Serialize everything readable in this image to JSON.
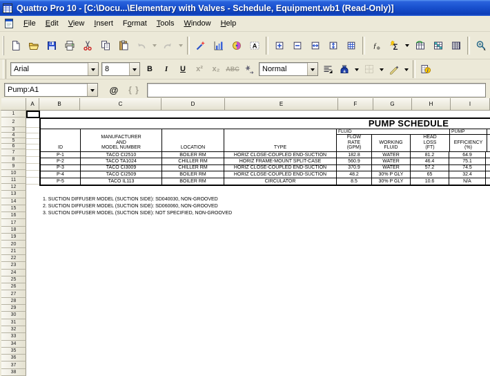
{
  "window": {
    "app_icon": "quattro-pro-app-icon",
    "title": "Quattro Pro 10 - [C:\\Docu...\\Elementary with Valves - Schedule, Equipment.wb1 (Read-Only)]"
  },
  "menus": [
    {
      "pre": "",
      "key": "F",
      "post": "ile"
    },
    {
      "pre": "",
      "key": "E",
      "post": "dit"
    },
    {
      "pre": "",
      "key": "V",
      "post": "iew"
    },
    {
      "pre": "",
      "key": "I",
      "post": "nsert"
    },
    {
      "pre": "F",
      "key": "o",
      "post": "rmat"
    },
    {
      "pre": "",
      "key": "T",
      "post": "ools"
    },
    {
      "pre": "",
      "key": "W",
      "post": "indow"
    },
    {
      "pre": "",
      "key": "H",
      "post": "elp"
    }
  ],
  "main_toolbar": {
    "items": [
      {
        "name": "new-document"
      },
      {
        "name": "open"
      },
      {
        "name": "save"
      },
      {
        "name": "print"
      },
      {
        "name": "cut"
      },
      {
        "name": "copy"
      },
      {
        "name": "paste"
      },
      {
        "name": "undo",
        "disabled": true
      },
      {
        "name": "undo-dropdown",
        "type": "arrow",
        "disabled": true
      },
      {
        "name": "redo",
        "disabled": true
      },
      {
        "name": "redo-dropdown",
        "type": "arrow",
        "disabled": true
      },
      {
        "type": "sep"
      },
      {
        "name": "quickformat"
      },
      {
        "name": "chart"
      },
      {
        "name": "clipart"
      },
      {
        "name": "text-box"
      },
      {
        "type": "sep"
      },
      {
        "name": "insert-cells"
      },
      {
        "name": "delete-cells"
      },
      {
        "name": "insert-columns"
      },
      {
        "name": "insert-rows"
      },
      {
        "name": "insert-sheet"
      },
      {
        "type": "sep"
      },
      {
        "name": "formula-composer"
      },
      {
        "name": "quicksum"
      },
      {
        "name": "quicksum-dropdown",
        "type": "arrow"
      },
      {
        "name": "speedformat"
      },
      {
        "name": "format-as-table"
      },
      {
        "name": "group-mode"
      },
      {
        "type": "sep"
      },
      {
        "name": "zoom"
      },
      {
        "name": "what-if"
      },
      {
        "name": "copy-cells"
      },
      {
        "name": "freeze-titles"
      },
      {
        "type": "sep"
      },
      {
        "name": "pan-workbook"
      }
    ]
  },
  "format_bar": {
    "font": "Arial",
    "size": "8",
    "style": "Normal",
    "bold": "B",
    "italic": "I",
    "underline": "U",
    "superscript": "x²",
    "subscript": "x₂",
    "strike": "ABC",
    "icon_buttons": [
      "insert-symbol",
      "alignment",
      "fill-color",
      "cell-borders",
      "line-color",
      "sheet-properties"
    ]
  },
  "formula_bar": {
    "cell_reference": "Pump:A1",
    "at_button": "@",
    "braces_button": "{ }",
    "input_value": ""
  },
  "sheet": {
    "selection": "A1",
    "columns": [
      "A",
      "B",
      "C",
      "D",
      "E",
      "F",
      "G",
      "H",
      "I"
    ],
    "row_numbers": [
      1,
      2,
      3,
      4,
      5,
      6,
      7,
      8,
      9,
      10,
      11,
      12,
      13,
      14,
      15,
      16,
      17,
      18,
      19,
      20,
      21,
      22,
      23,
      24,
      25,
      26,
      27,
      28,
      29,
      30,
      31,
      32,
      33,
      34,
      35,
      36,
      37,
      38
    ],
    "table": {
      "title": "PUMP SCHEDULE",
      "groups": {
        "fluid": "FLUID",
        "pump": "PUMP"
      },
      "headers": {
        "id": "ID",
        "manufacturer": [
          "MANUFACTURER",
          "AND",
          "MODEL NUMBER"
        ],
        "location": "LOCATION",
        "type": "TYPE",
        "flow": [
          "FLOW",
          "RATE",
          "(GPM)"
        ],
        "working": [
          "WORKING",
          "FLUID"
        ],
        "head": [
          "HEAD",
          "LOSS",
          "(FT)"
        ],
        "efficiency": [
          "EFFICIENCY",
          "(%)"
        ]
      },
      "rows": [
        {
          "id": "P-1",
          "model": "TACO CI2510",
          "location": "BOILER RM",
          "type": "HORIZ CLOSE-COUPLED END-SUCTION",
          "flow": "182.8",
          "fluid": "WATER",
          "head": "81.2",
          "eff": "64.9"
        },
        {
          "id": "P-2",
          "model": "TACO TA1024",
          "location": "CHILLER RM",
          "type": "HORIZ FRAME-MOUNT SPLIT-CASE",
          "flow": "560.9",
          "fluid": "WATER",
          "head": "46.4",
          "eff": "75.1"
        },
        {
          "id": "P-3",
          "model": "TACO CI3009",
          "location": "CHILLER RM",
          "type": "HORIZ CLOSE-COUPLED END-SUCTION",
          "flow": "370.9",
          "fluid": "WATER",
          "head": "57.2",
          "eff": "74.5"
        },
        {
          "id": "P-4",
          "model": "TACO CI2509",
          "location": "BOILER RM",
          "type": "HORIZ CLOSE-COUPLED END-SUCTION",
          "flow": "48.2",
          "fluid": "30% P GLY",
          "head": "65",
          "eff": "32.4"
        },
        {
          "id": "P-5",
          "model": "TACO IL113",
          "location": "BOILER RM",
          "type": "CIRCULATOR",
          "flow": "8.5",
          "fluid": "30% P GLY",
          "head": "10.6",
          "eff": "N/A"
        }
      ],
      "notes": [
        "1. SUCTION DIFFUSER MODEL (SUCTION SIDE): SD040030, NON-GROOVED",
        "2. SUCTION DIFFUSER MODEL (SUCTION SIDE): SD060060, NON-GROOVED",
        "3. SUCTION DIFFUSER MODEL (SUCTION SIDE): NOT SPECIFIED, NON-GROOVED"
      ]
    }
  }
}
